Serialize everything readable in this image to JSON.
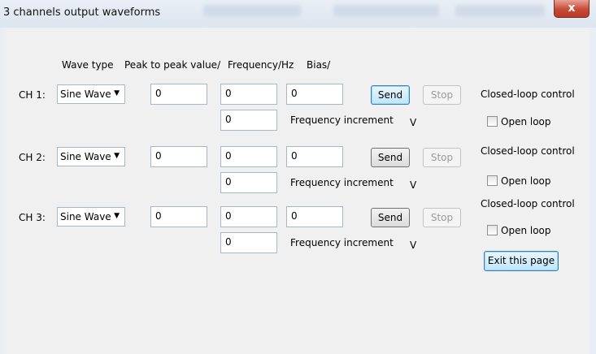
{
  "window": {
    "title": "3 channels  output waveforms",
    "close_glyph": "x"
  },
  "headers": {
    "wave_type": "Wave type",
    "peak": "Peak to peak value/",
    "freq": "Frequency/Hz",
    "bias": "Bias/"
  },
  "channels": [
    {
      "label": "CH 1:",
      "wave": "Sine Wave",
      "peak": "0",
      "freq": "0",
      "freq_inc": "0",
      "bias": "0",
      "freq_inc_label": "Frequency increment",
      "unit": "V",
      "send": "Send",
      "stop": "Stop",
      "control_label": "Closed-loop control",
      "open_loop": "Open loop"
    },
    {
      "label": "CH 2:",
      "wave": "Sine Wave",
      "peak": "0",
      "freq": "0",
      "freq_inc": "0",
      "bias": "0",
      "freq_inc_label": "Frequency increment",
      "unit": "V",
      "send": "Send",
      "stop": "Stop",
      "control_label": "Closed-loop control",
      "open_loop": "Open loop"
    },
    {
      "label": "CH 3:",
      "wave": "Sine Wave",
      "peak": "0",
      "freq": "0",
      "freq_inc": "0",
      "bias": "0",
      "freq_inc_label": "Frequency increment",
      "unit": "V",
      "send": "Send",
      "stop": "Stop",
      "control_label": "Closed-loop control",
      "open_loop": "Open loop"
    }
  ],
  "exit_button": "Exit this page",
  "icons": {
    "dropdown": "chevron-down-icon",
    "close": "close-icon"
  }
}
